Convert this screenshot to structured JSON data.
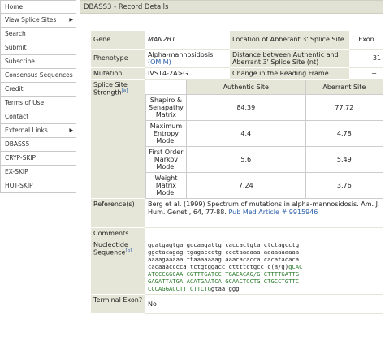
{
  "sidebar": {
    "items": [
      {
        "label": "Home",
        "arrow": false
      },
      {
        "label": "View Splice Sites",
        "arrow": true
      },
      {
        "label": "Search",
        "arrow": false
      },
      {
        "label": "Submit",
        "arrow": false
      },
      {
        "label": "Subscribe",
        "arrow": false
      },
      {
        "label": "Consensus Sequences",
        "arrow": false
      },
      {
        "label": "Credit",
        "arrow": false
      },
      {
        "label": "Terms of Use",
        "arrow": false
      },
      {
        "label": "Contact",
        "arrow": false
      },
      {
        "label": "External Links",
        "arrow": true
      },
      {
        "label": "DBASS5",
        "arrow": false
      },
      {
        "label": "CRYP-SKIP",
        "arrow": false
      },
      {
        "label": "EX-SKIP",
        "arrow": false
      },
      {
        "label": "HOT-SKIP",
        "arrow": false
      }
    ],
    "arrow_glyph": "▶"
  },
  "header": {
    "title": "DBASS3 - Record Details"
  },
  "record": {
    "gene_label": "Gene",
    "gene_value": "MAN2B1",
    "location_label": "Location of Abberant 3' Splice Site",
    "location_value": "Exon",
    "phenotype_label": "Phenotype",
    "phenotype_value": "Alpha-mannosidosis",
    "phenotype_link": "(OMIM)",
    "distance_label": "Distance between Authentic and Aberrant 3' Splice Site (nt)",
    "distance_value": "+31",
    "mutation_label": "Mutation",
    "mutation_value": "IVS14-2A>G",
    "frame_label": "Change in the Reading Frame",
    "frame_value": "+1",
    "strength_label": "Splice Site Strength",
    "strength_note": "[a]",
    "col_authentic": "Authentic Site",
    "col_aberrant": "Aberrant Site",
    "strength_rows": [
      {
        "model": "Shapiro & Senapathy Matrix",
        "authentic": "84.39",
        "aberrant": "77.72"
      },
      {
        "model": "Maximum Entropy Model",
        "authentic": "4.4",
        "aberrant": "4.78"
      },
      {
        "model": "First Order Markov Model",
        "authentic": "5.6",
        "aberrant": "5.49"
      },
      {
        "model": "Weight Matrix Model",
        "authentic": "7.24",
        "aberrant": "3.76"
      }
    ],
    "reference_label": "Reference(s)",
    "reference_text": "Berg et al. (1999) Spectrum of mutations in alpha-mannosidosis. Am. J. Hum. Genet., 64, 77-88.",
    "reference_link": "Pub Med Article # 9915946",
    "comments_label": "Comments",
    "comments_value": "",
    "sequence_label": "Nucleotide Sequence",
    "sequence_note": "[b]",
    "sequence_lines": [
      {
        "black": "ggatgagtga gccaagattg caccactgta ctctagcctg",
        "green": ""
      },
      {
        "black": "ggctacagag tgagaccctg ccctaaaaaa aaaaaaaaaa",
        "green": ""
      },
      {
        "black": "aaaagaaaaa ttaaaaaaag aaacacacca cacatacaca",
        "green": ""
      },
      {
        "black": "cacaaacccca tctgtggacc cttttctgcc c(a/g)",
        "green": "gCAC"
      },
      {
        "black": "",
        "green": "ATCCCGGCAA CGTTTGATCC TGACACAG/G CTTTTGATTG"
      },
      {
        "black": "",
        "green": "GAGATTATGA ACATGAATCA GCAACTCCTG CTGCCTGTTC"
      },
      {
        "black": "",
        "green": "CCCAGGACCTT CTTCTGgtaa ggg",
        "tail": ""
      }
    ],
    "terminal_label": "Terminal Exon?",
    "terminal_value": "No"
  }
}
